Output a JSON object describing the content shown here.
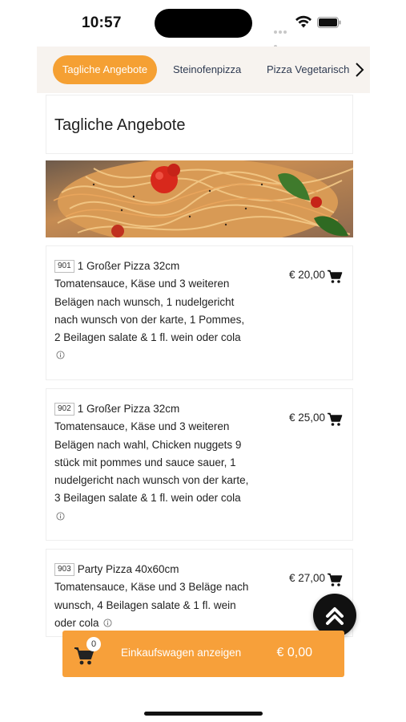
{
  "status_bar": {
    "time": "10:57"
  },
  "categories": {
    "active": "Tagliche Angebote",
    "tab2": "Steinofenpizza",
    "tab3": "Pizza Vegetarisch"
  },
  "section": {
    "title": "Tagliche Angebote"
  },
  "products": [
    {
      "number": "901",
      "name": "1 Großer Pizza 32cm",
      "description": "Tomatensauce, Käse und 3 weiteren Belägen nach wunsch, 1 nudelgericht nach wunsch von der karte, 1 Pommes, 2 Beilagen salate & 1 fl. wein oder cola",
      "price": "€ 20,00"
    },
    {
      "number": "902",
      "name": "1 Großer Pizza 32cm",
      "description": "Tomatensauce, Käse und 3 weiteren Belägen nach wahl, Chicken nuggets 9 stück mit pommes und sauce sauer, 1 nudelgericht nach wunsch von der karte, 3 Beilagen salate & 1 fl. wein oder cola",
      "price": "€ 25,00"
    },
    {
      "number": "903",
      "name": "Party Pizza 40x60cm",
      "description": "Tomatensauce, Käse und 3 Beläge nach wunsch, 4 Beilagen salate & 1 fl. wein oder cola",
      "price": "€ 27,00"
    }
  ],
  "checkout": {
    "badge_count": "0",
    "label": "Einkaufswagen anzeigen",
    "total": "€ 0,00"
  },
  "colors": {
    "accent": "#f5a033",
    "checkout_bar": "#f7a03a"
  },
  "icons": [
    "wifi-icon",
    "battery-icon",
    "chevron-right-icon",
    "cart-icon",
    "info-icon",
    "double-chevron-up-icon"
  ]
}
